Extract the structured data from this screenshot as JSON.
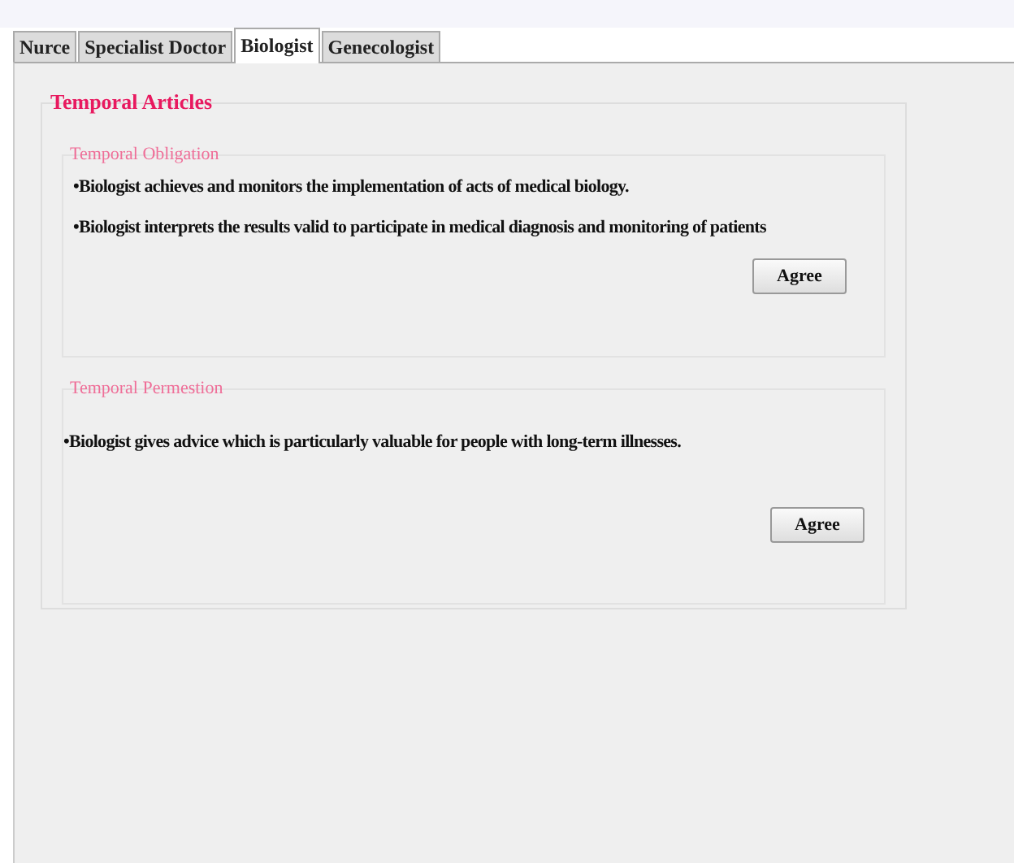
{
  "tabs": [
    {
      "label": "Nurce",
      "selected": false
    },
    {
      "label": "Specialist Doctor",
      "selected": false
    },
    {
      "label": "Biologist",
      "selected": true
    },
    {
      "label": "Genecologist",
      "selected": false
    }
  ],
  "articles": {
    "title": "Temporal Articles",
    "groups": [
      {
        "title": "Temporal Obligation",
        "items": [
          "•Biologist achieves and monitors the implementation of acts of medical biology.",
          "•Biologist interprets the results valid to participate in medical diagnosis and monitoring of patients"
        ],
        "button": "Agree"
      },
      {
        "title": "Temporal Permestion",
        "items": [
          "•Biologist gives advice which is particularly valuable for people with long-term illnesses."
        ],
        "button": "Agree"
      }
    ]
  }
}
